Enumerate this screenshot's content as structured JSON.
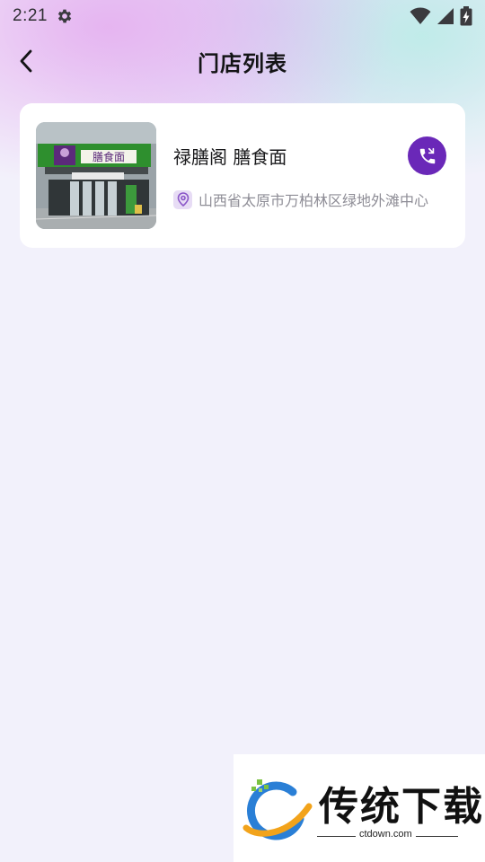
{
  "status_bar": {
    "time": "2:21",
    "icons": [
      "gear-icon",
      "wifi-icon",
      "cell-signal-icon",
      "battery-charging-icon"
    ]
  },
  "nav": {
    "back_icon": "chevron-left-icon",
    "title": "门店列表"
  },
  "store": {
    "name": "禄膳阁 膳食面",
    "address": "山西省太原市万柏林区绿地外滩中心",
    "sign_text": "膳食面",
    "call_icon": "phone-icon",
    "location_icon": "location-pin-icon"
  },
  "watermark": {
    "brand": "传统下载",
    "url": "ctdown.com"
  },
  "colors": {
    "accent": "#6a28b8",
    "card": "#ffffff",
    "background": "#f2f1fb",
    "store_sign": "#2e8f2e"
  }
}
